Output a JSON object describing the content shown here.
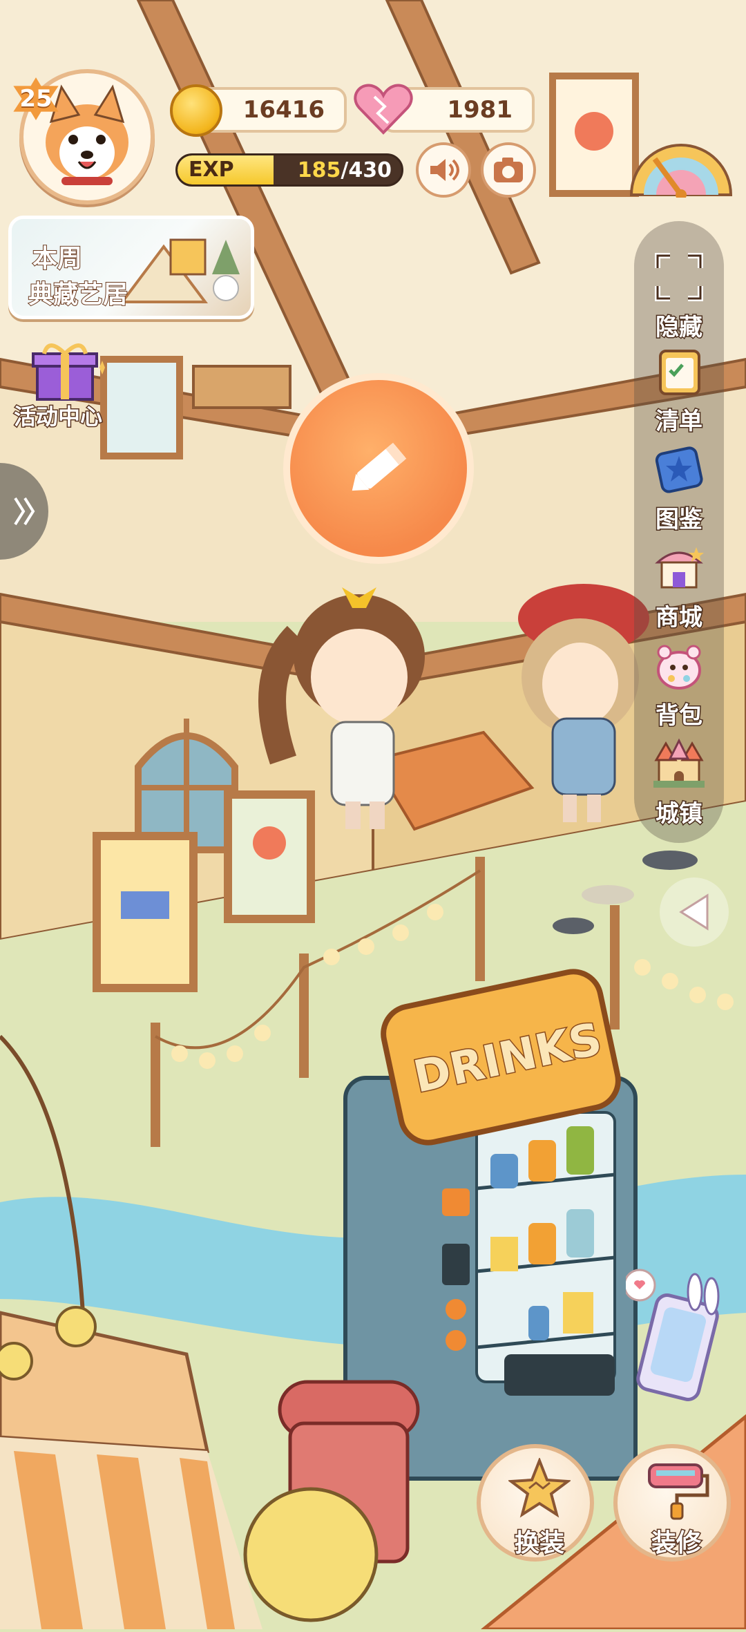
{
  "player": {
    "level": "25",
    "avatar_icon": "corgi-dog-avatar",
    "coins": "16416",
    "hearts": "1981",
    "exp_label": "EXP",
    "exp_current": "185",
    "exp_max": "/430",
    "exp_fraction": 0.43
  },
  "hud_buttons": {
    "sound_icon": "speaker-icon",
    "camera_icon": "camera-icon",
    "gauge_icon": "rainbow-gauge-icon"
  },
  "left_panel": {
    "weekly_event_line1": "本周",
    "weekly_event_line2": "典藏艺居",
    "activity_center": "活动中心",
    "expand_icon": "chevron-right-icon"
  },
  "center": {
    "edit_icon": "pencil-icon"
  },
  "side_menu": [
    {
      "label": "隐藏",
      "icon": "fullscreen-icon"
    },
    {
      "label": "清单",
      "icon": "checklist-icon"
    },
    {
      "label": "图鉴",
      "icon": "star-book-icon"
    },
    {
      "label": "商城",
      "icon": "shop-icon"
    },
    {
      "label": "背包",
      "icon": "bag-icon"
    },
    {
      "label": "城镇",
      "icon": "castle-icon"
    }
  ],
  "scene": {
    "vending_sign": "DRINKS"
  },
  "bottom_buttons": {
    "dress_up": "换装",
    "decorate": "装修",
    "phone_icon": "phone-icon"
  },
  "colors": {
    "accent_orange": "#f6894a",
    "text_outline": "#5a3420",
    "exp_fill": "#f5c82c"
  }
}
